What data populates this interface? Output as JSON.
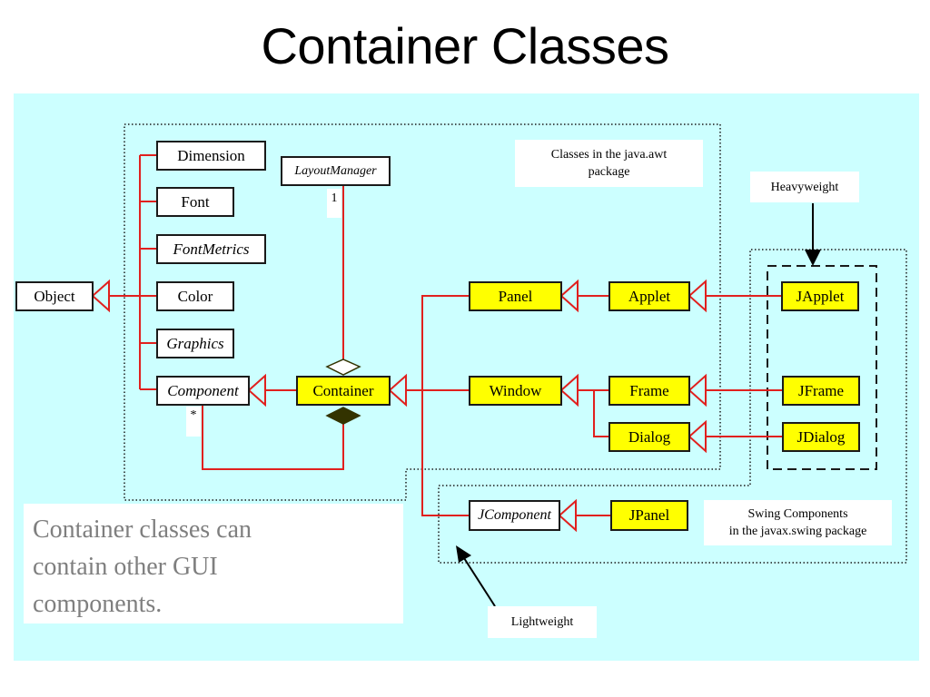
{
  "title": "Container Classes",
  "classes": {
    "object": "Object",
    "dimension": "Dimension",
    "font": "Font",
    "font_metrics": "FontMetrics",
    "color": "Color",
    "graphics": "Graphics",
    "component": "Component",
    "container": "Container",
    "layout_manager": "LayoutManager",
    "panel": "Panel",
    "applet": "Applet",
    "window": "Window",
    "frame": "Frame",
    "dialog": "Dialog",
    "japplet": "JApplet",
    "jframe": "JFrame",
    "jdialog": "JDialog",
    "jcomponent": "JComponent",
    "jpanel": "JPanel"
  },
  "multiplicity": {
    "layout_manager": "1",
    "component": "*"
  },
  "notes": {
    "awt_package": [
      "Classes in the java.awt",
      "package"
    ],
    "heavyweight": "Heavyweight",
    "lightweight": "Lightweight",
    "swing_package": [
      "Swing Components",
      "in the javax.swing package"
    ]
  },
  "caption": [
    "Container classes can",
    "contain other GUI",
    "components."
  ],
  "colors": {
    "background": "#ccffff",
    "swing_awt_class_fill": "#ffff00",
    "relationship_line": "#e0201e",
    "caption_text": "#7f7f7f"
  }
}
